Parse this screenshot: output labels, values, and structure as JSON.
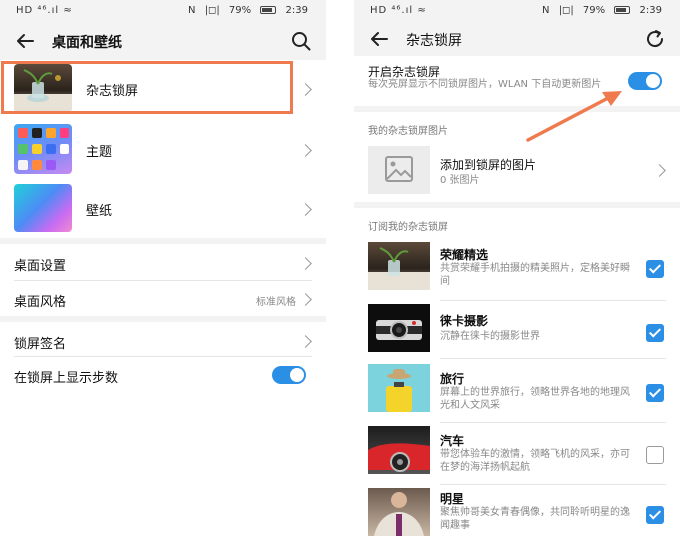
{
  "left": {
    "status": {
      "left": "HD ⁴⁶.ıl ≈",
      "right": [
        "N",
        "|◻|",
        "79%",
        "2:39"
      ]
    },
    "title": "桌面和壁纸",
    "items": [
      {
        "label": "杂志锁屏"
      },
      {
        "label": "主题"
      },
      {
        "label": "壁纸"
      }
    ],
    "settings": [
      {
        "label": "桌面设置",
        "value": ""
      },
      {
        "label": "桌面风格",
        "value": "标准风格"
      }
    ],
    "lock": [
      {
        "label": "锁屏签名"
      },
      {
        "label": "在锁屏上显示步数",
        "toggle_on": true
      }
    ]
  },
  "right": {
    "status": {
      "left": "HD ⁴⁶.ıl ≈",
      "right": [
        "N",
        "|◻|",
        "79%",
        "2:39"
      ]
    },
    "title": "杂志锁屏",
    "enable": {
      "title": "开启杂志锁屏",
      "desc": "每次亮屏显示不同锁屏图片，WLAN 下自动更新图片",
      "toggle_on": true
    },
    "my_pictures": {
      "section": "我的杂志锁屏图片",
      "title": "添加到锁屏的图片",
      "count": "0 张图片"
    },
    "subscribe": {
      "section": "订阅我的杂志锁屏",
      "items": [
        {
          "title": "荣耀精选",
          "desc": "共赏荣耀手机拍摄的精美照片，定格美好瞬间",
          "checked": true
        },
        {
          "title": "徕卡摄影",
          "desc": "沉静在徕卡的摄影世界",
          "checked": true
        },
        {
          "title": "旅行",
          "desc": "屏幕上的世界旅行，领略世界各地的地理风光和人文风采",
          "checked": true
        },
        {
          "title": "汽车",
          "desc": "带您体验车的激情，领略飞机的风采，亦可在梦的海洋扬帆起航",
          "checked": false
        },
        {
          "title": "明星",
          "desc": "聚焦帅哥美女青春偶像，共同聆听明星的逸闻趣事",
          "checked": true
        }
      ]
    }
  },
  "colors": {
    "accent": "#2c8fe6",
    "highlight": "#ef7a4e",
    "background": "#f3f3f3"
  }
}
